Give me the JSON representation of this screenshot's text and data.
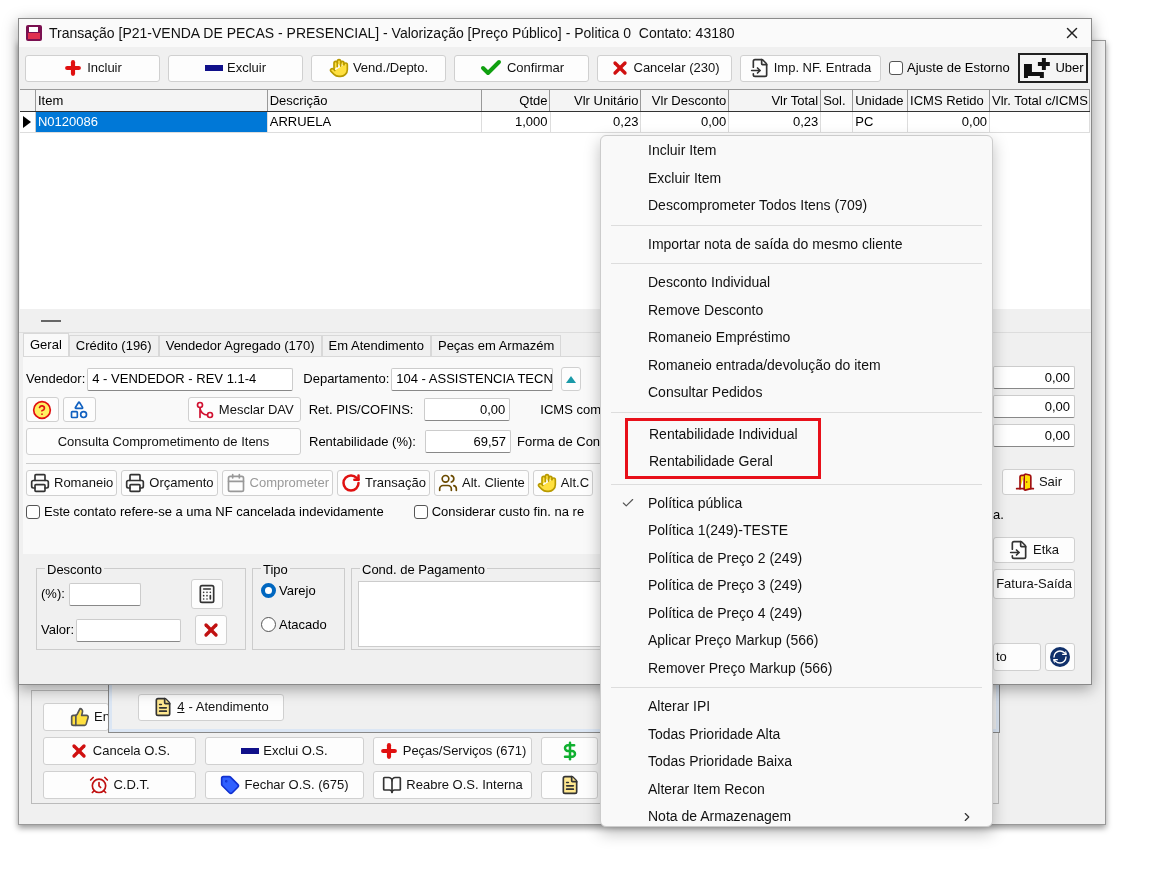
{
  "window": {
    "title": "Transação [P21-VENDA DE PECAS - PRESENCIAL] - Valorização [Preço Público] - Politica 0  Contato: 43180"
  },
  "toolbar": {
    "buttons": [
      "Incluir",
      "Excluir",
      "Vend./Depto.",
      "Confirmar",
      "Cancelar (230)",
      "Imp. NF. Entrada"
    ],
    "checkbox": {
      "label": "Ajuste de Estorno",
      "checked": false
    },
    "uber": "Uber"
  },
  "table": {
    "columns": [
      "Item",
      "Descrição",
      "Qtde",
      "Vlr Unitário",
      "Vlr Desconto",
      "Vlr Total",
      "Sol.",
      "Unidade",
      "ICMS Retido",
      "Vlr. Total c/ICMS"
    ],
    "rows": [
      {
        "selected": true,
        "item": "N0120086",
        "descricao": "ARRUELA",
        "qtde": "1,000",
        "vlr_unitario": "0,23",
        "vlr_desconto": "0,00",
        "vlr_total": "0,23",
        "unidade": "PC",
        "icms_retido": "0,00"
      }
    ]
  },
  "tabs": [
    {
      "label": "Geral",
      "selected": true
    },
    {
      "label": "Crédito (196)",
      "selected": false
    },
    {
      "label": "Vendedor Agregado (170)",
      "selected": false
    },
    {
      "label": "Em Atendimento",
      "selected": false
    },
    {
      "label": "Peças em Armazém",
      "selected": false
    }
  ],
  "geral": {
    "vendedor_label": "Vendedor:",
    "vendedor_value": "4 - VENDEDOR - REV 1.1-4",
    "departamento_label": "Departamento:",
    "departamento_value": "104 - ASSISTENCIA TECN",
    "mesclar_button": "Mesclar DAV",
    "ret_pis_label": "Ret. PIS/COFINS:",
    "ret_pis_value": "0,00",
    "icms_label": "ICMS com",
    "consulta_button": "Consulta Comprometimento de Itens",
    "rentabilidade_label": "Rentabilidade (%):",
    "rentabilidade_value": "69,57",
    "forma_label": "Forma de Con",
    "action_buttons": [
      {
        "label": "Romaneio",
        "disabled": false
      },
      {
        "label": "Orçamento",
        "disabled": false
      },
      {
        "label": "Comprometer",
        "disabled": true
      },
      {
        "label": "Transação",
        "disabled": false
      },
      {
        "label": "Alt. Cliente",
        "disabled": false
      },
      {
        "label": "Alt.C",
        "disabled": false
      }
    ],
    "checkboxes": [
      {
        "label": "Este contato refere-se a uma NF cancelada indevidamente",
        "checked": false
      },
      {
        "label": "Considerar custo fin. na re",
        "checked": false
      }
    ]
  },
  "desconto": {
    "title": "Desconto",
    "percent_label": "(%):",
    "valor_label": "Valor:"
  },
  "tipo": {
    "title": "Tipo",
    "options": [
      {
        "label": "Varejo",
        "selected": true
      },
      {
        "label": "Atacado",
        "selected": false
      }
    ]
  },
  "cond_pagamento": {
    "title": "Cond. de Pagamento"
  },
  "right_panel": {
    "fields": [
      "0,00",
      "0,00",
      "0,00"
    ],
    "sair": "Sair",
    "note": "a.",
    "etka": "Etka",
    "fatura": "Fatura-Saída",
    "partial_button": "to"
  },
  "context_menu": {
    "sections": [
      {
        "kind": "plain",
        "items": [
          {
            "label": "Incluir Item",
            "checked": false,
            "submenu": false
          },
          {
            "label": "Excluir Item",
            "checked": false,
            "submenu": false
          },
          {
            "label": "Descomprometer Todos Itens (709)",
            "checked": false,
            "submenu": false
          }
        ]
      },
      {
        "kind": "plain",
        "items": [
          {
            "label": "Importar nota de saída do mesmo cliente",
            "checked": false,
            "submenu": false
          }
        ]
      },
      {
        "kind": "plain",
        "items": [
          {
            "label": "Desconto Individual",
            "checked": false,
            "submenu": false
          },
          {
            "label": "Remove Desconto",
            "checked": false,
            "submenu": false
          },
          {
            "label": "Romaneio Empréstimo",
            "checked": false,
            "submenu": false
          },
          {
            "label": "Romaneio entrada/devolução do item",
            "checked": false,
            "submenu": false
          },
          {
            "label": "Consultar Pedidos",
            "checked": false,
            "submenu": false
          }
        ]
      },
      {
        "kind": "highlighted",
        "items": [
          {
            "label": "Rentabilidade Individual",
            "checked": false,
            "submenu": false
          },
          {
            "label": "Rentabilidade Geral",
            "checked": false,
            "submenu": false
          }
        ]
      },
      {
        "kind": "plain",
        "items": [
          {
            "label": "Política pública",
            "checked": true,
            "submenu": false
          },
          {
            "label": "Política 1(249)-TESTE",
            "checked": false,
            "submenu": false
          },
          {
            "label": "Política de Preço 2 (249)",
            "checked": false,
            "submenu": false
          },
          {
            "label": "Política de Preço 3 (249)",
            "checked": false,
            "submenu": false
          },
          {
            "label": "Política de Preço 4 (249)",
            "checked": false,
            "submenu": false
          },
          {
            "label": "Aplicar Preço Markup (566)",
            "checked": false,
            "submenu": false
          },
          {
            "label": "Remover Preço Markup (566)",
            "checked": false,
            "submenu": false
          }
        ]
      },
      {
        "kind": "plain",
        "items": [
          {
            "label": "Alterar IPI",
            "checked": false,
            "submenu": false
          },
          {
            "label": "Todas Prioridade Alta",
            "checked": false,
            "submenu": false
          },
          {
            "label": "Todas Prioridade Baixa",
            "checked": false,
            "submenu": false
          },
          {
            "label": "Alterar Item Recon",
            "checked": false,
            "submenu": false
          },
          {
            "label": "Nota de Armazenagem",
            "checked": false,
            "submenu": true
          }
        ]
      }
    ]
  },
  "middle_window": {
    "button_shortcut": "4",
    "button_label": "- Atendimento"
  },
  "back_window": {
    "rows": [
      [
        {
          "kind": "text",
          "label": "En"
        }
      ],
      [
        {
          "kind": "text",
          "label": "Cancela O.S."
        },
        {
          "kind": "text",
          "label": "Exclui O.S."
        },
        {
          "kind": "text",
          "label": "Peças/Serviços (671)"
        },
        {
          "kind": "icon"
        }
      ],
      [
        {
          "kind": "text",
          "label": "C.D.T."
        },
        {
          "kind": "text",
          "label": "Fechar O.S. (675)"
        },
        {
          "kind": "text",
          "label": "Reabre O.S. Interna"
        },
        {
          "kind": "icon"
        }
      ]
    ]
  }
}
